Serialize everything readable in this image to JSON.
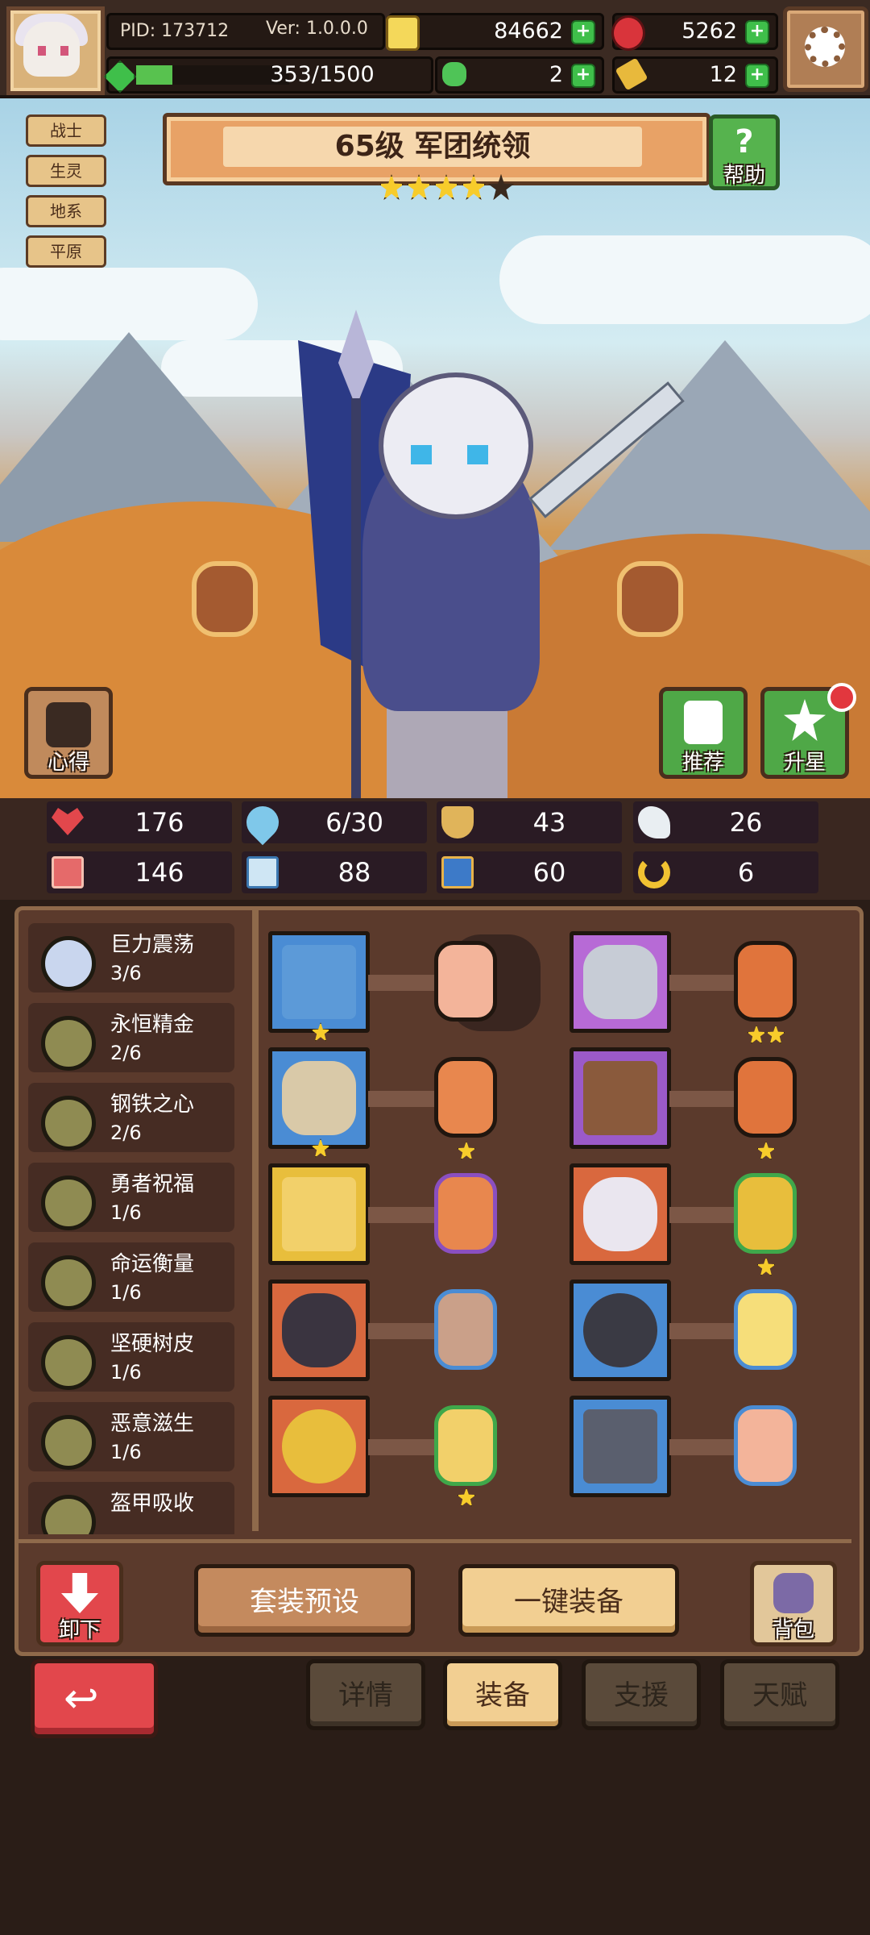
{
  "topbar": {
    "pid": "PID: 173712",
    "version": "Ver: 1.0.0.0",
    "coins": "84662",
    "gems": "5262",
    "exp": "353/1500",
    "exp_fraction": 0.235,
    "clover": "2",
    "scroll": "12"
  },
  "tags": [
    "战士",
    "生灵",
    "地系",
    "平原"
  ],
  "hero": {
    "title": "65级  军团统领",
    "stars_filled": 4,
    "stars_total": 5
  },
  "buttons": {
    "help": "帮助",
    "insight": "心得",
    "recommend": "推荐",
    "star_up": "升星",
    "unequip": "卸下",
    "preset": "套装预设",
    "one_click": "一键装备",
    "bag": "背包"
  },
  "stats": [
    {
      "icon": "heart-icon",
      "value": "176"
    },
    {
      "icon": "water-drop-icon",
      "value": "6/30"
    },
    {
      "icon": "shield-icon",
      "value": "43"
    },
    {
      "icon": "wing-icon",
      "value": "26"
    },
    {
      "icon": "fist-icon",
      "value": "146"
    },
    {
      "icon": "book-icon",
      "value": "88"
    },
    {
      "icon": "boot-icon",
      "value": "60"
    },
    {
      "icon": "horseshoe-icon",
      "value": "6"
    }
  ],
  "sets": [
    {
      "name": "巨力震荡",
      "count": "3/6"
    },
    {
      "name": "永恒精金",
      "count": "2/6"
    },
    {
      "name": "钢铁之心",
      "count": "2/6"
    },
    {
      "name": "勇者祝福",
      "count": "1/6"
    },
    {
      "name": "命运衡量",
      "count": "1/6"
    },
    {
      "name": "坚硬树皮",
      "count": "1/6"
    },
    {
      "name": "恶意滋生",
      "count": "1/6"
    },
    {
      "name": "盔甲吸收",
      "count": ""
    }
  ],
  "tabs": {
    "details": "详情",
    "equipment": "装备",
    "support": "支援",
    "talent": "天赋"
  },
  "colors": {
    "accent": "#f2cf92",
    "back_button": "#e2474c",
    "help_button": "#56b34e",
    "star": "#f7cc2b"
  }
}
